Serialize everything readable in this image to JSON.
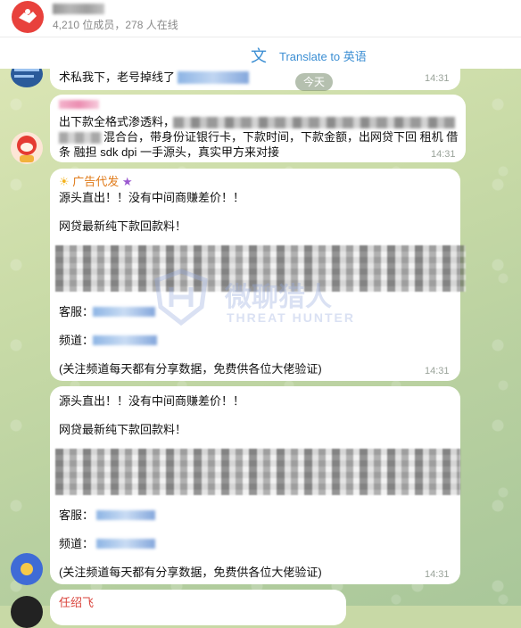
{
  "header": {
    "title": "",
    "subtitle": "4,210 位成员，278 人在线"
  },
  "translate": {
    "label": "Translate to 英语"
  },
  "date_separator": "今天",
  "messages": [
    {
      "text": "术私我下，老号掉线了",
      "time": "14:31"
    },
    {
      "line1": "出下款全格式渗透料，",
      "line2": "混合台，带身份证银行卡，下款时间，下款金额，出网贷下回 租机 借",
      "line3": "条 融担 sdk dpi 一手源头，真实甲方来对接",
      "time": "14:31"
    },
    {
      "sender": "广告代发",
      "line1": "源头直出！！没有中间商赚差价！！",
      "line2": "网贷最新纯下款回款料！",
      "service_label": "客服：",
      "channel_label": "频道：",
      "footer": "(关注频道每天都有分享数据，免费供各位大佬验证)",
      "time": "14:31"
    },
    {
      "line1": "源头直出！！没有中间商赚差价！！",
      "line2": "网贷最新纯下款回款料！",
      "service_label": "客服：",
      "channel_label": "频道：",
      "footer": "(关注频道每天都有分享数据，免费供各位大佬验证)",
      "time": "14:31"
    },
    {
      "sender": "任绍飞"
    }
  ],
  "watermark": {
    "main": "微聊猎人",
    "sub": "THREAT HUNTER"
  },
  "colors": {
    "link": "#3b8ed3",
    "sender_orange": "#e07b1a",
    "sender_red": "#d9423a",
    "time": "#9aa39a"
  }
}
